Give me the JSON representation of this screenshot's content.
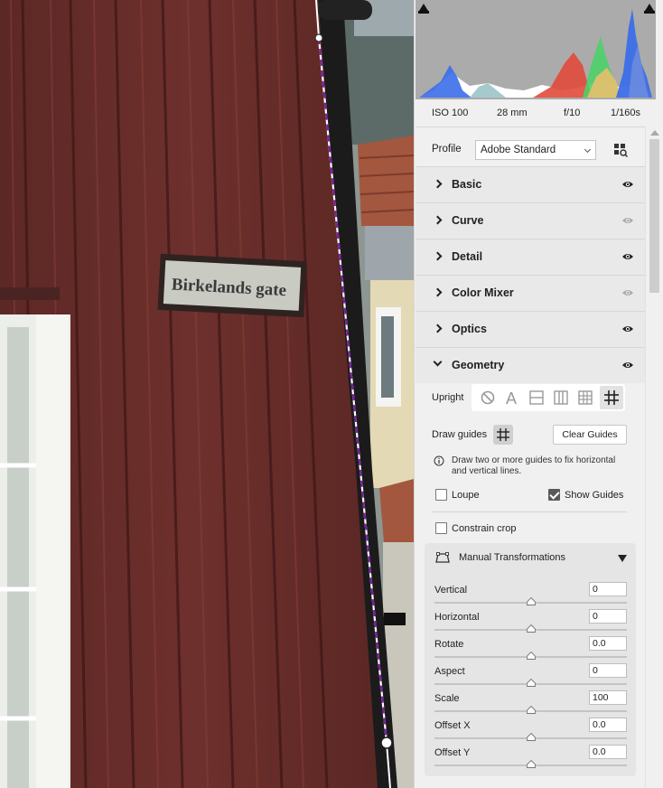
{
  "photo": {
    "sign_text": "Birkelands gate",
    "colors": {
      "wall": "#6a2e2a",
      "wall_dark": "#4a1f1c",
      "sky": "#9aa3a5",
      "guide_dash": "#7a1fa0",
      "pipe": "#1b1b1b"
    }
  },
  "histogram": {
    "colors": {
      "blue": "#3b6ee8",
      "green": "#4ed06a",
      "red": "#e04a3a",
      "yellow": "#e6c06c",
      "white": "#ffffff",
      "bg": "#ababab"
    }
  },
  "exif": {
    "iso": "ISO 100",
    "focal": "28 mm",
    "aperture": "f/10",
    "shutter": "1/160s"
  },
  "profile": {
    "label": "Profile",
    "value": "Adobe Standard",
    "browser_icon": "grid-search-icon"
  },
  "sections": [
    {
      "title": "Basic",
      "visible": true
    },
    {
      "title": "Curve",
      "visible": false
    },
    {
      "title": "Detail",
      "visible": true
    },
    {
      "title": "Color Mixer",
      "visible": false
    },
    {
      "title": "Optics",
      "visible": true
    },
    {
      "title": "Geometry",
      "visible": true,
      "expanded": true
    }
  ],
  "geometry": {
    "upright_label": "Upright",
    "upright_modes": [
      "off-icon",
      "auto-icon",
      "level-icon",
      "vertical-icon",
      "full-icon",
      "guided-icon"
    ],
    "upright_active": "guided-icon",
    "draw_guides_label": "Draw guides",
    "clear_guides_label": "Clear Guides",
    "info_text": "Draw two or more guides to fix horizontal and vertical lines.",
    "loupe_label": "Loupe",
    "loupe_checked": false,
    "show_guides_label": "Show Guides",
    "show_guides_checked": true,
    "constrain_crop_label": "Constrain crop",
    "constrain_crop_checked": false,
    "manual": {
      "title": "Manual Transformations",
      "sliders": [
        {
          "label": "Vertical",
          "value": "0",
          "position": 0.5
        },
        {
          "label": "Horizontal",
          "value": "0",
          "position": 0.5
        },
        {
          "label": "Rotate",
          "value": "0.0",
          "position": 0.5
        },
        {
          "label": "Aspect",
          "value": "0",
          "position": 0.5
        },
        {
          "label": "Scale",
          "value": "100",
          "position": 0.5
        },
        {
          "label": "Offset X",
          "value": "0.0",
          "position": 0.5
        },
        {
          "label": "Offset Y",
          "value": "0.0",
          "position": 0.5
        }
      ]
    }
  }
}
